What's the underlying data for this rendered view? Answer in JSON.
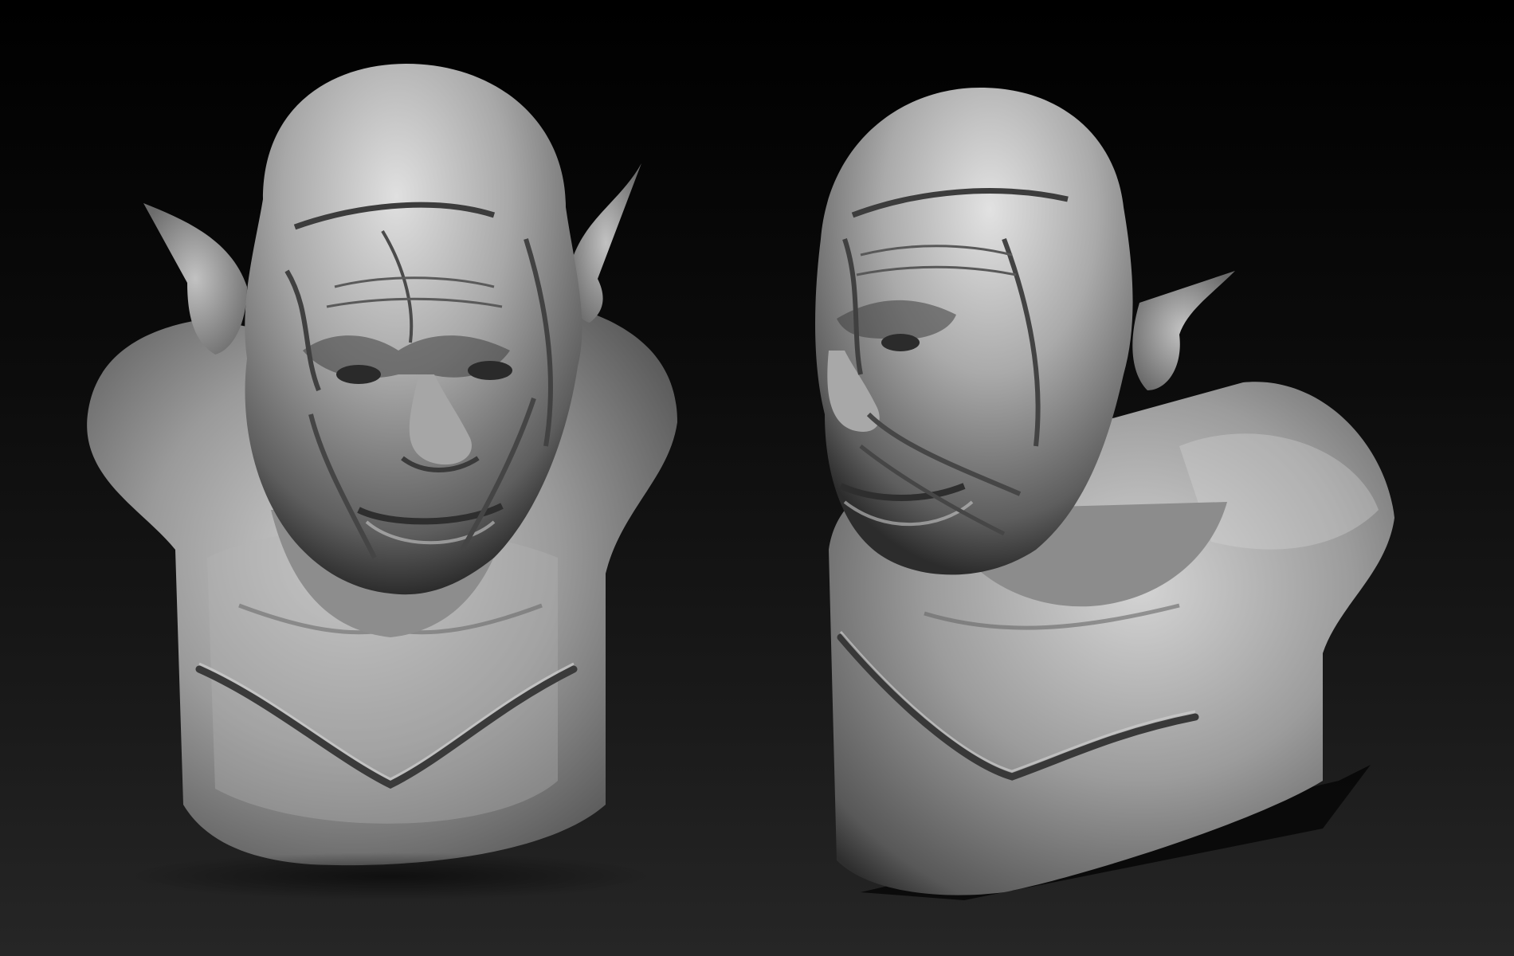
{
  "scene": {
    "background_top": "#000000",
    "background_bottom": "#262626",
    "material_color": "#9b9b9b",
    "subjects": [
      {
        "view": "front",
        "icon": "orc-bust-front-icon"
      },
      {
        "view": "three-quarter",
        "icon": "orc-bust-three-quarter-icon"
      }
    ]
  }
}
